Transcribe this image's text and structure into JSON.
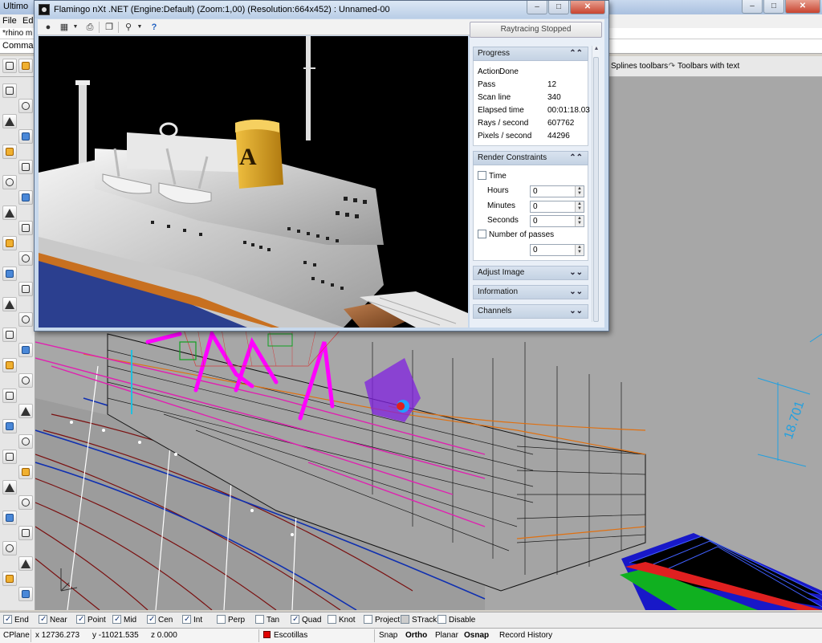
{
  "rhino": {
    "title": "Ultimo",
    "menus": [
      "File",
      "Edit"
    ],
    "document_line": "*rhino m",
    "command_line": "Comman",
    "toolbar_tabs": [
      "Splines toolbars",
      "Toolbars with text"
    ],
    "dimension_value": "18.701",
    "osnaps": [
      {
        "label": "End",
        "checked": true
      },
      {
        "label": "Near",
        "checked": true
      },
      {
        "label": "Point",
        "checked": true
      },
      {
        "label": "Mid",
        "checked": true
      },
      {
        "label": "Cen",
        "checked": true
      },
      {
        "label": "Int",
        "checked": true
      },
      {
        "label": "Perp",
        "checked": false
      },
      {
        "label": "Tan",
        "checked": false
      },
      {
        "label": "Quad",
        "checked": true
      },
      {
        "label": "Knot",
        "checked": false
      },
      {
        "label": "Project",
        "checked": false
      },
      {
        "label": "STrack",
        "checked": false
      },
      {
        "label": "Disable",
        "checked": false
      }
    ],
    "status": {
      "cplane": "CPlane",
      "x": "x 12736.273",
      "y": "y -11021.535",
      "z": "z 0.000",
      "layer": "Escotillas",
      "layer_color": "#e00000",
      "snap": "Snap",
      "ortho": "Ortho",
      "planar": "Planar",
      "osnap": "Osnap",
      "record_history": "Record History"
    }
  },
  "flamingo": {
    "title": "Flamingo nXt .NET (Engine:Default) (Zoom:1,00) (Resolution:664x452) : Unnamed-00",
    "toolbar_icons": [
      "record-icon",
      "save-icon",
      "dropdown-icon",
      "print-icon",
      "copy-icon",
      "zoom-icon",
      "dropdown-icon",
      "help-icon"
    ],
    "status_button": "Raytracing Stopped",
    "progress": {
      "header": "Progress",
      "action_label": "Action",
      "action_value": "Done",
      "rows": [
        {
          "label": "Pass",
          "value": "12"
        },
        {
          "label": "Scan line",
          "value": "340"
        },
        {
          "label": "Elapsed time",
          "value": "00:01:18.03"
        },
        {
          "label": "Rays / second",
          "value": "607762"
        },
        {
          "label": "Pixels / second",
          "value": "44296"
        }
      ]
    },
    "constraints": {
      "header": "Render Constraints",
      "time_label": "Time",
      "time_checked": false,
      "hours_label": "Hours",
      "hours_value": "0",
      "minutes_label": "Minutes",
      "minutes_value": "0",
      "seconds_label": "Seconds",
      "seconds_value": "0",
      "passes_label": "Number of passes",
      "passes_checked": false,
      "passes_value": "0"
    },
    "collapsed_sections": [
      "Adjust Image",
      "Information",
      "Channels"
    ],
    "funnel_letter": "A"
  }
}
